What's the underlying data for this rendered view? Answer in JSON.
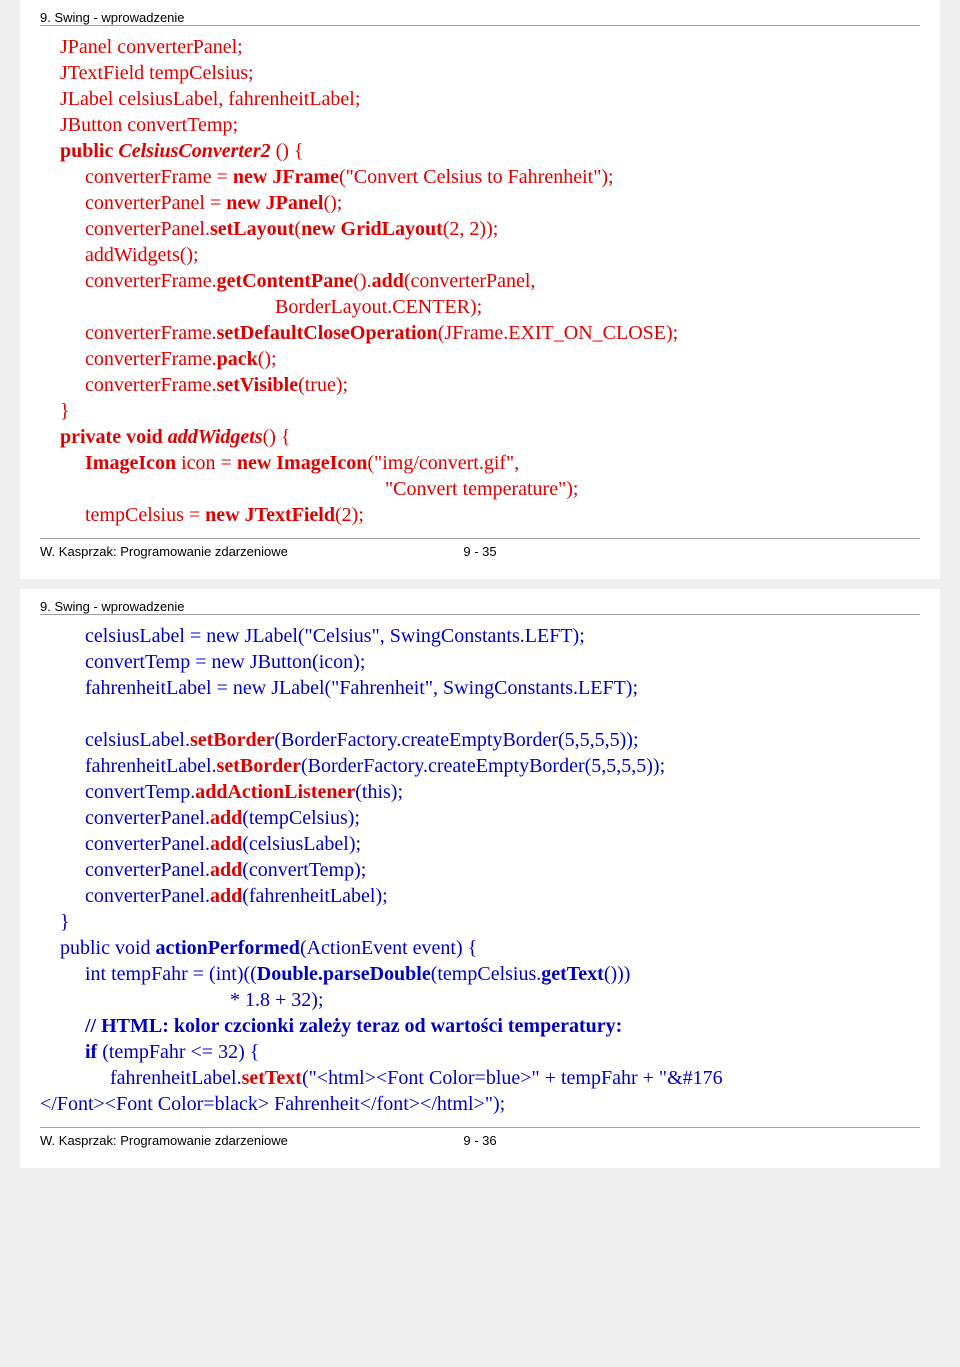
{
  "slide1": {
    "header": "9. Swing - wprowadzenie",
    "l1": "JPanel converterPanel;",
    "l2": "JTextField tempCelsius;",
    "l3": "JLabel celsiusLabel, fahrenheitLabel;",
    "l4": "JButton convertTemp;",
    "l5a": "public",
    "l5b": "CelsiusConverter2",
    "l5c": "() {",
    "l6a": "converterFrame = ",
    "l6b": "new JFrame",
    "l6c": "(\"Convert Celsius to Fahrenheit\");",
    "l7a": "converterPanel = ",
    "l7b": "new JPanel",
    "l7c": "();",
    "l8a": "converterPanel.",
    "l8b": "setLayout",
    "l8c": "(",
    "l8d": "new GridLayout",
    "l8e": "(2, 2));",
    "l9": "addWidgets();",
    "l10a": "converterFrame.",
    "l10b": "getContentPane",
    "l10c": "().",
    "l10d": "add",
    "l10e": "(converterPanel,",
    "l10f": "BorderLayout.CENTER);",
    "l11a": "converterFrame.",
    "l11b": "setDefaultCloseOperation",
    "l11c": "(JFrame.EXIT_ON_CLOSE);",
    "l12a": "converterFrame.",
    "l12b": "pack",
    "l12c": "();",
    "l13a": "converterFrame.",
    "l13b": "setVisible",
    "l13c": "(true);",
    "l14": "}",
    "l15a": "private void ",
    "l15b": "addWidgets",
    "l15c": "() {",
    "l16a": "ImageIcon",
    "l16b": " icon = ",
    "l16c": "new ImageIcon",
    "l16d": "(\"img/convert.gif\",",
    "l16e": "\"Convert temperature\");",
    "l17a": "tempCelsius = ",
    "l17b": "new JTextField",
    "l17c": "(2);",
    "footer": "W. Kasprzak: Programowanie zdarzeniowe",
    "pagenum": "9 - 35"
  },
  "slide2": {
    "header": "9. Swing - wprowadzenie",
    "l1": "celsiusLabel = new JLabel(\"Celsius\", SwingConstants.LEFT);",
    "l2": "convertTemp = new JButton(icon);",
    "l3": "fahrenheitLabel = new JLabel(\"Fahrenheit\", SwingConstants.LEFT);",
    "l4a": "celsiusLabel.",
    "l4b": "setBorder",
    "l4c": "(BorderFactory.createEmptyBorder(5,5,5,5));",
    "l5a": "fahrenheitLabel.",
    "l5b": "setBorder",
    "l5c": "(BorderFactory.createEmptyBorder(5,5,5,5));",
    "l6a": "convertTemp.",
    "l6b": "addActionListener",
    "l6c": "(this);",
    "l7a": "converterPanel.",
    "l7b": "add",
    "l7c": "(tempCelsius);",
    "l8a": "converterPanel.",
    "l8b": "add",
    "l8c": "(celsiusLabel);",
    "l9a": "converterPanel.",
    "l9b": "add",
    "l9c": "(convertTemp);",
    "l10a": "converterPanel.",
    "l10b": "add",
    "l10c": "(fahrenheitLabel);",
    "l11": "}",
    "l12a": "public void ",
    "l12b": "actionPerformed",
    "l12c": "(ActionEvent event) {",
    "l13a": "int tempFahr = (int)((",
    "l13b": "Double.parseDouble",
    "l13c": "(tempCelsius.",
    "l13d": "getText",
    "l13e": "()))",
    "l13f": "* 1.8 + 32);",
    "l14": "// HTML: kolor czcionki zależy teraz od wartości temperatury:",
    "l15a": "if",
    "l15b": " (tempFahr <= 32) {",
    "l16a": "fahrenheitLabel.",
    "l16b": "setText",
    "l16c": "(\"<html><Font Color=blue>\" + tempFahr + \"&#176 ",
    "l16d": "</Font><Font Color=black> Fahrenheit</font></html>\");",
    "footer": "W. Kasprzak: Programowanie zdarzeniowe",
    "pagenum": "9 - 36"
  }
}
